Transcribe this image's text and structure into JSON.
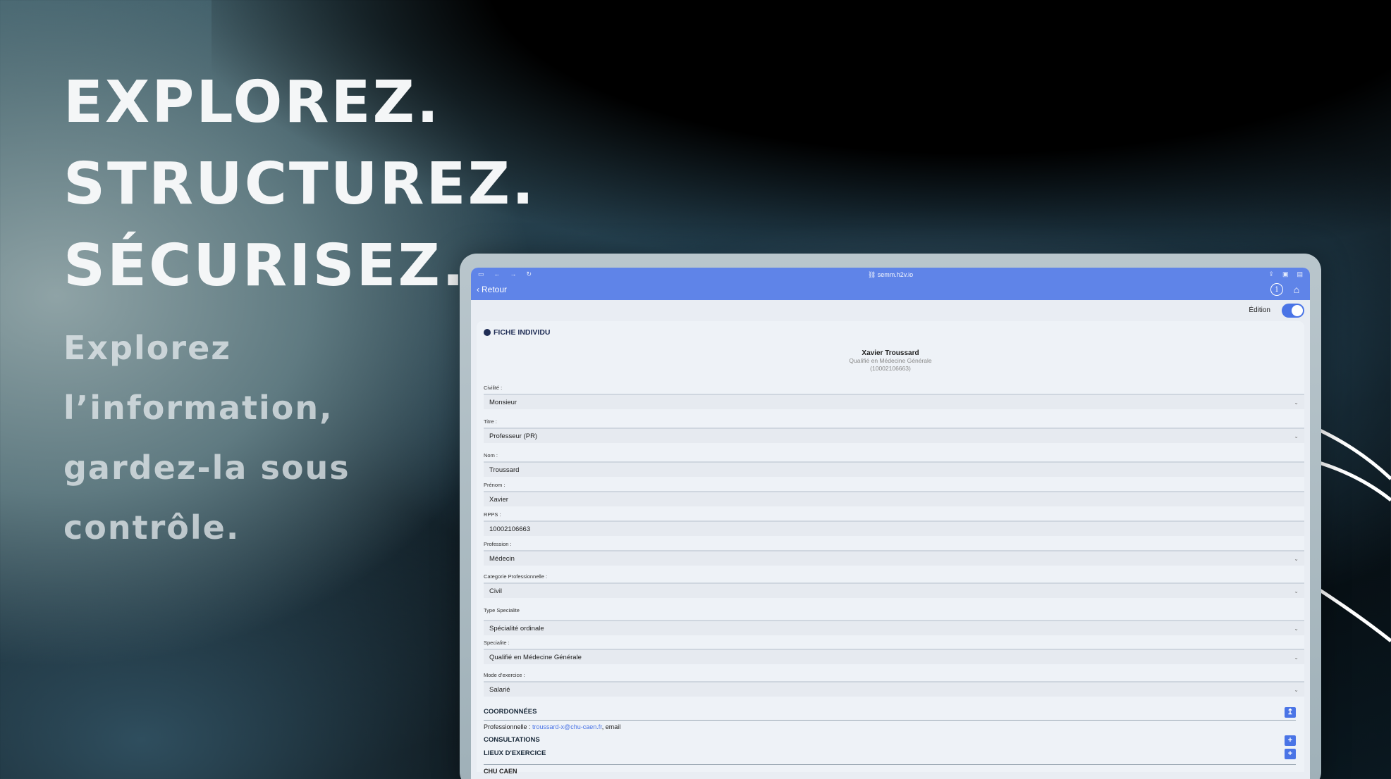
{
  "hero": {
    "headline": [
      "EXPLOREZ.",
      "STRUCTUREZ.",
      "SÉCURISEZ."
    ],
    "subline": [
      "Explorez",
      "l’information,",
      "gardez-la sous",
      "contrôle."
    ]
  },
  "browser": {
    "url": "semm.h2v.io",
    "back_label": "Retour"
  },
  "edition": {
    "label": "Édition",
    "enabled": true
  },
  "card": {
    "title": "FICHE INDIVIDU",
    "person": {
      "name": "Xavier Troussard",
      "qualification": "Qualifié en Médecine Générale",
      "id": "(10002106663)"
    },
    "fields": [
      {
        "label": "Civilité :",
        "value": "Monsieur",
        "type": "select"
      },
      {
        "label": "Titre :",
        "value": "Professeur (PR)",
        "type": "select"
      },
      {
        "label": "Nom :",
        "value": "Troussard",
        "type": "text"
      },
      {
        "label": "Prénom :",
        "value": "Xavier",
        "type": "text"
      },
      {
        "label": "RPPS :",
        "value": "10002106663",
        "type": "text"
      },
      {
        "label": "Profession :",
        "value": "Médecin",
        "type": "select"
      },
      {
        "label": "Categorie Professionnelle :",
        "value": "Civil",
        "type": "select"
      },
      {
        "label": "Type Specialite",
        "value": "Spécialité ordinale",
        "type": "select"
      },
      {
        "label": "Specialite :",
        "value": "Qualifié en Médecine Générale",
        "type": "select"
      },
      {
        "label": "Mode d'exercice :",
        "value": "Salarié",
        "type": "select"
      }
    ],
    "coordonnees": {
      "title": "COORDONNÉES",
      "prefix": "Professionnelle : ",
      "email": "troussard-x@chu-caen.fr",
      "suffix": ", email"
    },
    "consultations": {
      "title": "CONSULTATIONS"
    },
    "lieux": {
      "title": "LIEUX D'EXERCICE",
      "first": "CHU CAEN"
    }
  },
  "colors": {
    "accent": "#4a74e6",
    "topbar": "#5f84e8"
  }
}
